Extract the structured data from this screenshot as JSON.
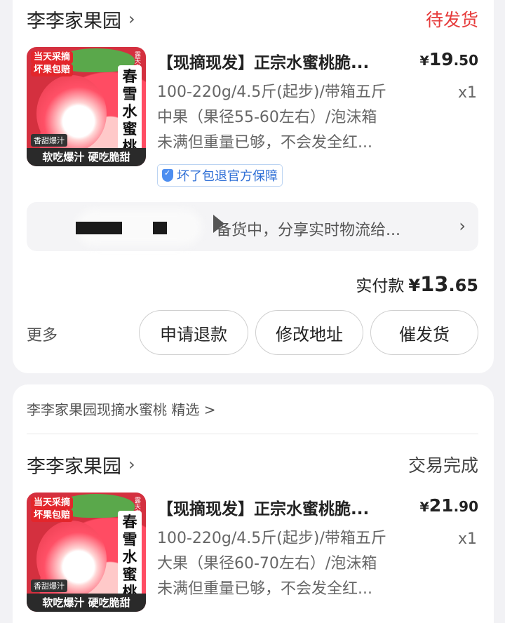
{
  "order1": {
    "shop_name": "李李家果园",
    "status": "待发货",
    "status_color": "#e63b3b",
    "product_title": "【现摘现发】正宗水蜜桃脆...",
    "price_currency": "¥",
    "price_int": "19",
    "price_dec": ".50",
    "spec_line1": "100-220g/4.5斤(起步)/带箱五斤",
    "spec_line2": "中果（果径55-60左右）/泡沫箱",
    "spec_line3": "未满但重量已够，不会发全红...",
    "qty": "x1",
    "guarantee": "坏了包退官方保障",
    "logistics_text": "备货中，分享实时物流给...",
    "paid_label": "实付款",
    "paid_currency": "¥",
    "paid_int": "13",
    "paid_dec": ".65",
    "more": "更多",
    "buttons": [
      "申请退款",
      "修改地址",
      "催发货"
    ]
  },
  "recommend": {
    "text": "李李家果园现摘水蜜桃 精选 >"
  },
  "order2": {
    "shop_name": "李李家果园",
    "status": "交易完成",
    "status_color": "#444444",
    "product_title": "【现摘现发】正宗水蜜桃脆...",
    "price_currency": "¥",
    "price_int": "21",
    "price_dec": ".90",
    "spec_line1": "100-220g/4.5斤(起步)/带箱五斤",
    "spec_line2": "大果（果径60-70左右）/泡沫箱",
    "spec_line3": "未满但重量已够，不会发全红...",
    "qty": "x1"
  },
  "thumbnail": {
    "tag1": "当天采摘",
    "tag2": "坏果包赔",
    "brand": "春雪水蜜桃",
    "tiny": "露天自然熟",
    "juicy": "香甜爆汁",
    "slogan": "软吃爆汁 硬吃脆甜"
  },
  "icons": {
    "chevron": "chevron-right-icon",
    "shield": "shield-check-icon"
  }
}
